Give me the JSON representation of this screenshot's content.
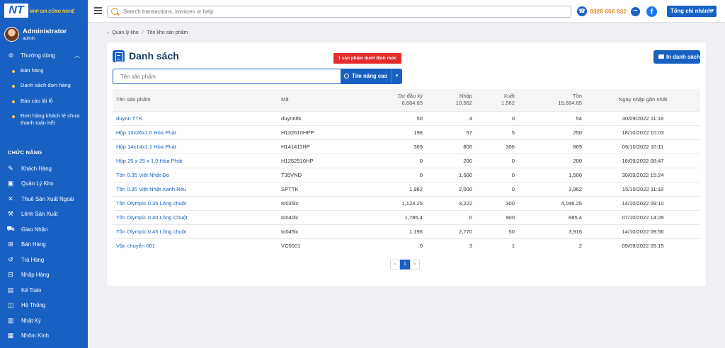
{
  "sidebar": {
    "logo_main": "NT",
    "logo_sub": "NHP GIA CÔNG NGHỆ",
    "user": {
      "name": "Administrator",
      "role": "admin"
    },
    "frequent": {
      "label": "Thường dùng",
      "items": [
        {
          "label": "Bán hàng"
        },
        {
          "label": "Danh sách đơn hàng"
        },
        {
          "label": "Báo cáo lãi lỗ"
        },
        {
          "label": "Đơn hàng khách lẻ chưa thanh toán hết"
        }
      ]
    },
    "functions_label": "CHỨC NĂNG",
    "nav": [
      {
        "label": "Khách Hàng",
        "icon": "user-edit-icon"
      },
      {
        "label": "Quản Lý Kho",
        "icon": "warehouse-icon"
      },
      {
        "label": "Thuê Sản Xuất Ngoài",
        "icon": "tools-icon"
      },
      {
        "label": "Lệnh Sản Xuất",
        "icon": "production-icon"
      },
      {
        "label": "Giao Nhận",
        "icon": "truck-icon"
      },
      {
        "label": "Bán Hàng",
        "icon": "cart-icon"
      },
      {
        "label": "Trả Hàng",
        "icon": "return-icon"
      },
      {
        "label": "Nhập Hàng",
        "icon": "import-icon"
      },
      {
        "label": "Kế Toán",
        "icon": "accounting-icon"
      },
      {
        "label": "Hệ Thống",
        "icon": "system-icon"
      },
      {
        "label": "Nhật Ký",
        "icon": "log-icon"
      },
      {
        "label": "Nhôm Kính",
        "icon": "glass-icon"
      }
    ]
  },
  "topbar": {
    "search_placeholder": "Search transactions, invoices or help",
    "phone": "0328 666 932",
    "branch": "Tổng chi nhánh"
  },
  "breadcrumb": {
    "parent": "Quản lý kho",
    "current": "Tồn kho sản phẩm"
  },
  "page": {
    "title": "Danh sách",
    "alert": "1 sản phẩm dưới định mức",
    "print_label": "In danh sách",
    "filter_placeholder": "Tên sản phẩm",
    "advanced_label": "Tìm nâng cao"
  },
  "table": {
    "headers": {
      "name": "Tên sản phẩm",
      "code": "Mã",
      "opening": "Dư đầu kỳ",
      "opening_total": "6,684.65",
      "import": "Nhập",
      "import_total": "10,562",
      "export": "Xuất",
      "export_total": "1,562",
      "stock": "Tồn",
      "stock_total": "15,684.65",
      "date": "Ngày nhập gần nhất"
    },
    "rows": [
      {
        "name": "duynn TTK",
        "code": "duynnttk",
        "opening": "50",
        "import": "4",
        "export": "0",
        "stock": "54",
        "date": "30/09/2022 11:18"
      },
      {
        "name": "Hộp 13x26x1.0 Hòa Phát",
        "code": "H132610HPP",
        "opening": "198",
        "import": "57",
        "export": "5",
        "stock": "250",
        "date": "18/10/2022 10:03"
      },
      {
        "name": "Hộp 14x14x1.1 Hòa Phát",
        "code": "H141411HP",
        "opening": "369",
        "import": "806",
        "export": "306",
        "stock": "869",
        "date": "06/10/2022 10:11"
      },
      {
        "name": "Hộp 25 x 25 x 1.0 Hòa Phát",
        "code": "H1252510HP",
        "opening": "0",
        "import": "200",
        "export": "0",
        "stock": "200",
        "date": "16/09/2022 08:47"
      },
      {
        "name": "Tôn 0.35 Việt Nhật Đỏ",
        "code": "T35VNĐ",
        "opening": "0",
        "import": "1,500",
        "export": "0",
        "stock": "1,500",
        "date": "30/09/2022 15:24"
      },
      {
        "name": "Tôn 0.35 Việt Nhật Xanh Rêu",
        "code": "SPTTK",
        "opening": "1,962",
        "import": "2,000",
        "export": "0",
        "stock": "3,962",
        "date": "15/10/2022 11:18"
      },
      {
        "name": "Tôn Olympic 0.35 Lông chuột",
        "code": "to035lc",
        "opening": "1,124.25",
        "import": "3,222",
        "export": "300",
        "stock": "4,046.25",
        "date": "14/10/2022 09:10"
      },
      {
        "name": "Tôn Olympic 0.40 Lông Chuột",
        "code": "to040lc",
        "opening": "1,785.4",
        "import": "0",
        "export": "900",
        "stock": "885.4",
        "date": "07/10/2022 14:28"
      },
      {
        "name": "Tôn Olympic 0.45 Lông chuột",
        "code": "to045lc",
        "opening": "1,196",
        "import": "2,770",
        "export": "50",
        "stock": "3,916",
        "date": "14/10/2022 09:56"
      },
      {
        "name": "Vận chuyển 001",
        "code": "VC0001",
        "opening": "0",
        "import": "3",
        "export": "1",
        "stock": "2",
        "date": "09/09/2022 09:15"
      }
    ]
  },
  "pagination": {
    "prev": "«",
    "current": "1",
    "next": "»"
  }
}
